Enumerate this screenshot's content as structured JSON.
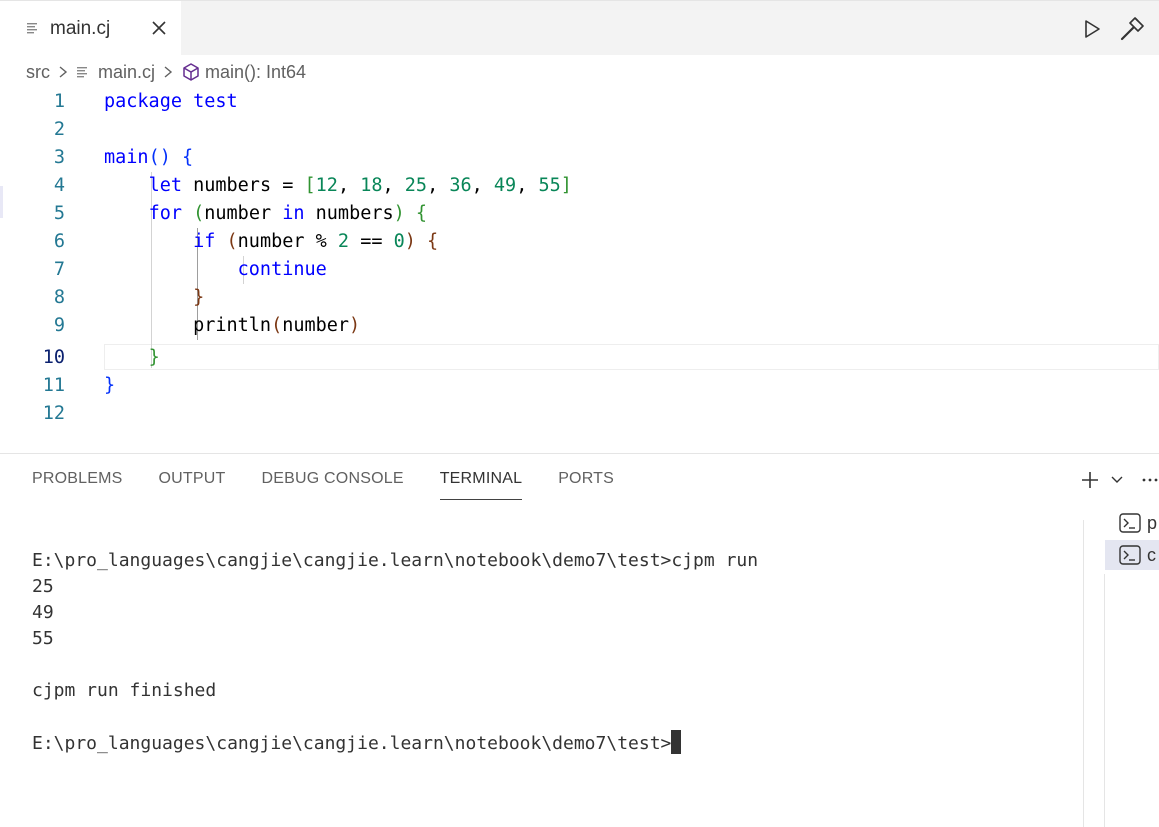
{
  "tab": {
    "label": "main.cj"
  },
  "breadcrumb": {
    "folder": "src",
    "file": "main.cj",
    "symbol": "main(): Int64"
  },
  "editor": {
    "active_line": 10,
    "lines": [
      {
        "n": "1"
      },
      {
        "n": "2"
      },
      {
        "n": "3"
      },
      {
        "n": "4"
      },
      {
        "n": "5"
      },
      {
        "n": "6"
      },
      {
        "n": "7"
      },
      {
        "n": "8"
      },
      {
        "n": "9"
      },
      {
        "n": "10"
      },
      {
        "n": "11"
      },
      {
        "n": "12"
      }
    ],
    "tokens": {
      "package": "package",
      "test": "test",
      "main": "main",
      "let": "let",
      "numbers_decl": " numbers = ",
      "n12": "12",
      "n18": "18",
      "n25": "25",
      "n36": "36",
      "n49": "49",
      "n55": "55",
      "for": "for",
      "number_in": "number ",
      "in": "in",
      "numbers_ref": " numbers",
      "if": "if",
      "cond": "number % ",
      "two": "2",
      "eqeq": " == ",
      "zero": "0",
      "continue": "continue",
      "println": "println",
      "number_arg": "number"
    }
  },
  "panel": {
    "tabs": [
      "PROBLEMS",
      "OUTPUT",
      "DEBUG CONSOLE",
      "TERMINAL",
      "PORTS"
    ],
    "active_tab": "TERMINAL"
  },
  "terminal": {
    "lines": [
      "E:\\pro_languages\\cangjie\\cangjie.learn\\notebook\\demo7\\test>cjpm run",
      "25",
      "49",
      "55",
      "",
      "cjpm run finished",
      "",
      "E:\\pro_languages\\cangjie\\cangjie.learn\\notebook\\demo7\\test>"
    ]
  },
  "terminal_list": {
    "items": [
      "p",
      "c"
    ]
  }
}
